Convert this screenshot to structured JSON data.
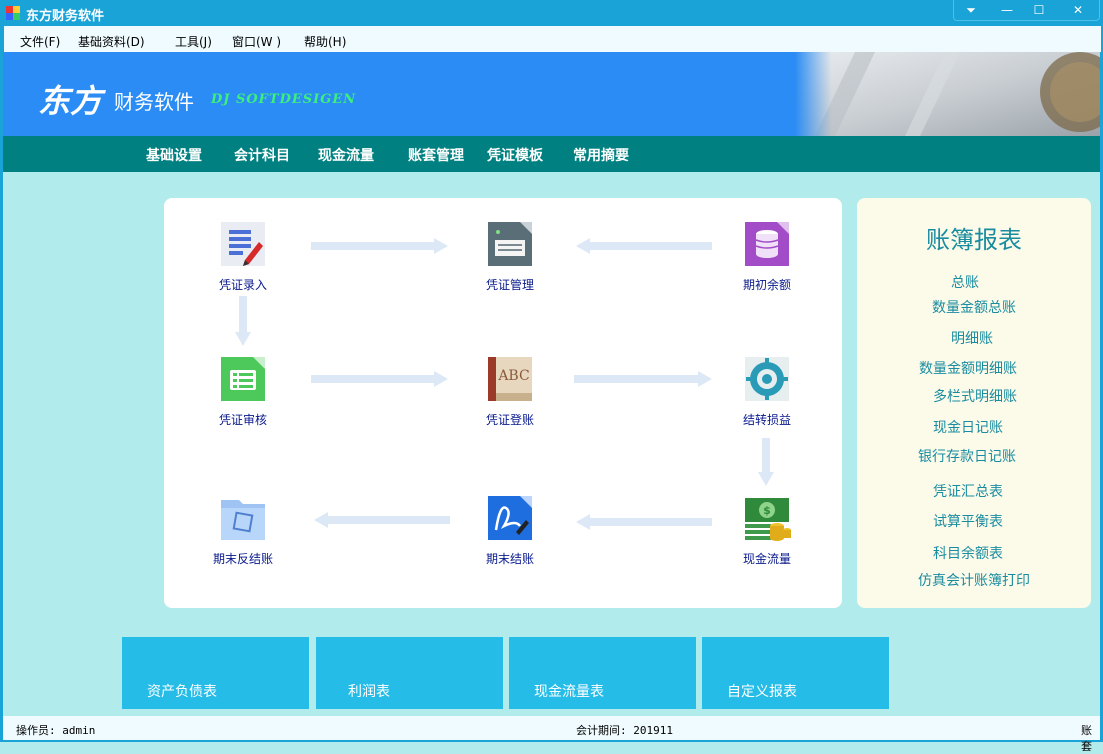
{
  "window": {
    "title": "东方财务软件",
    "controls": {
      "dropdown": "⏷",
      "minimize": "—",
      "maximize": "☐",
      "close": "✕"
    }
  },
  "menu": [
    {
      "label": "文件(F)"
    },
    {
      "label": "基础资料(D)"
    },
    {
      "label": "工具(J)"
    },
    {
      "label": "窗口(W )"
    },
    {
      "label": "帮助(H)"
    }
  ],
  "banner": {
    "brand_big": "东方",
    "brand_small": "财务软件",
    "tagline": "DJ SOFTDESIGEN"
  },
  "nav": [
    {
      "label": "基础设置"
    },
    {
      "label": "会计科目"
    },
    {
      "label": "现金流量"
    },
    {
      "label": "账套管理"
    },
    {
      "label": "凭证模板"
    },
    {
      "label": "常用摘要"
    }
  ],
  "flow": {
    "voucher_entry": {
      "label": "凭证录入",
      "icon": "document-edit-icon"
    },
    "voucher_manage": {
      "label": "凭证管理",
      "icon": "printer-icon"
    },
    "opening_balance": {
      "label": "期初余额",
      "icon": "coin-stack-icon"
    },
    "voucher_review": {
      "label": "凭证审核",
      "icon": "list-check-icon"
    },
    "voucher_post": {
      "label": "凭证登账",
      "icon": "book-abc-icon"
    },
    "carry_forward": {
      "label": "结转损益",
      "icon": "gear-icon"
    },
    "reverse_close": {
      "label": "期末反结账",
      "icon": "folder-icon"
    },
    "period_close": {
      "label": "期末结账",
      "icon": "signature-icon"
    },
    "cash_flow": {
      "label": "现金流量",
      "icon": "money-icon"
    }
  },
  "reports": {
    "title": "账簿报表",
    "links": [
      {
        "label": "总账"
      },
      {
        "label": "数量金额总账"
      },
      {
        "label": "明细账"
      },
      {
        "label": "数量金额明细账"
      },
      {
        "label": "多栏式明细账"
      },
      {
        "label": "现金日记账"
      },
      {
        "label": "银行存款日记账"
      },
      {
        "label": "凭证汇总表"
      },
      {
        "label": "试算平衡表"
      },
      {
        "label": "科目余额表"
      },
      {
        "label": "仿真会计账簿打印"
      }
    ]
  },
  "tiles": [
    {
      "label": "资产负债表"
    },
    {
      "label": "利润表"
    },
    {
      "label": "现金流量表"
    },
    {
      "label": "自定义报表"
    }
  ],
  "status": {
    "operator": "操作员: admin",
    "period": "会计期间: 201911",
    "account_set": "账套"
  },
  "colors": {
    "titlebar": "#1aa3d6",
    "banner": "#2a8cf4",
    "nav": "#008080",
    "background": "#b2ebeb",
    "tile": "#25bde8",
    "report_link": "#1a8ca0"
  }
}
